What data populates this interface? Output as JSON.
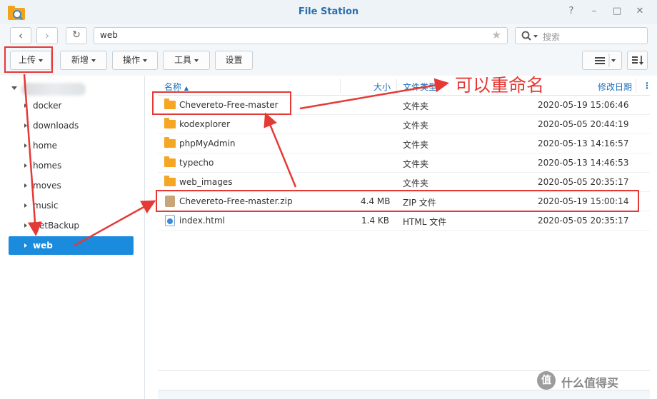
{
  "window": {
    "title": "File Station",
    "help": "?",
    "minimize": "–",
    "maximize": "□",
    "close": "✕"
  },
  "nav": {
    "back": "‹",
    "forward": "›",
    "refresh": "↻",
    "path": "web",
    "star": "★",
    "search_placeholder": "搜索"
  },
  "toolbar": {
    "upload": "上传",
    "new": "新增",
    "action": "操作",
    "tools": "工具",
    "settings": "设置"
  },
  "sidebar": {
    "items": [
      {
        "label": "docker"
      },
      {
        "label": "downloads"
      },
      {
        "label": "home"
      },
      {
        "label": "homes"
      },
      {
        "label": "moves"
      },
      {
        "label": "music"
      },
      {
        "label": "NetBackup"
      },
      {
        "label": "web"
      }
    ]
  },
  "table": {
    "columns": {
      "name": "名称",
      "size": "大小",
      "type": "文件类型",
      "modified": "修改日期"
    },
    "rows": [
      {
        "name": "Chevereto-Free-master",
        "size": "",
        "type": "文件夹",
        "modified": "2020-05-19 15:06:46",
        "icon": "folder-icon"
      },
      {
        "name": "kodexplorer",
        "size": "",
        "type": "文件夹",
        "modified": "2020-05-05 20:44:19",
        "icon": "folder-icon"
      },
      {
        "name": "phpMyAdmin",
        "size": "",
        "type": "文件夹",
        "modified": "2020-05-13 14:16:57",
        "icon": "folder-icon"
      },
      {
        "name": "typecho",
        "size": "",
        "type": "文件夹",
        "modified": "2020-05-13 14:46:53",
        "icon": "folder-icon"
      },
      {
        "name": "web_images",
        "size": "",
        "type": "文件夹",
        "modified": "2020-05-05 20:35:17",
        "icon": "folder-icon"
      },
      {
        "name": "Chevereto-Free-master.zip",
        "size": "4.4 MB",
        "type": "ZIP 文件",
        "modified": "2020-05-19 15:00:14",
        "icon": "zip-file-icon"
      },
      {
        "name": "index.html",
        "size": "1.4 KB",
        "type": "HTML 文件",
        "modified": "2020-05-05 20:35:17",
        "icon": "html-file-icon"
      }
    ]
  },
  "annotation": {
    "text": "可以重命名",
    "color": "#e53935"
  },
  "watermark": {
    "badge": "值",
    "text": "什么值得买"
  },
  "colors": {
    "accent": "#1a8bdd",
    "title": "#2a6fad",
    "folder": "#f5a623"
  }
}
